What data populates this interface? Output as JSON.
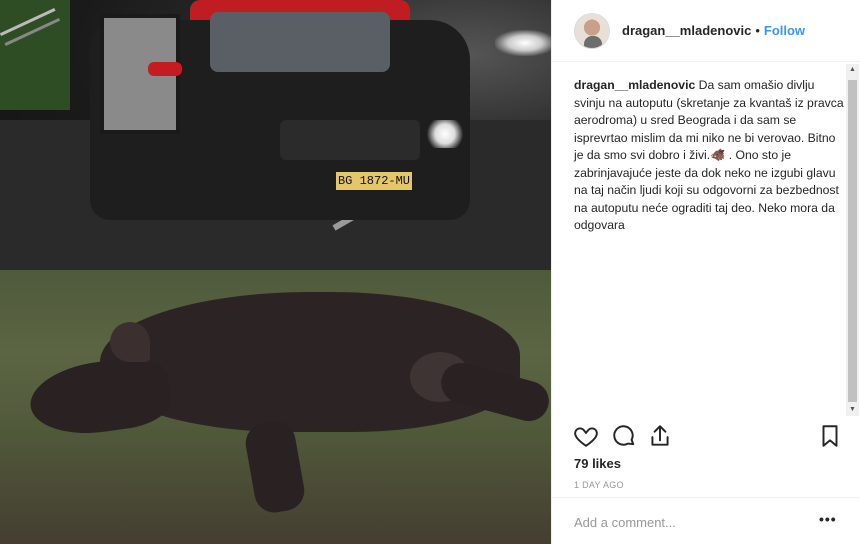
{
  "header": {
    "username": "dragan__mladenovic",
    "separator": "•",
    "follow_label": "Follow"
  },
  "post": {
    "author": "dragan__mladenovic",
    "caption": "Da sam omašio divlju svinju na autoputu (skretanje za kvantaš iz pravca aerodroma) u sred Beograda i da sam se isprevrtao mislim da mi niko ne bi verovao. Bitno je da smo svi dobro i živi.🐗 . Ono sto je zabrinjavajuće jeste da dok neko ne izgubi glavu na taj način ljudi koji su odgovorni za bezbednost na autoputu neće ograditi taj deo. Neko mora da odgovara",
    "likes": "79 likes",
    "timestamp": "1 DAY AGO",
    "plate": "BG 1872-MU"
  },
  "comment_box": {
    "placeholder": "Add a comment...",
    "more_label": "•••"
  },
  "icons": {
    "like": "heart-icon",
    "comment": "comment-icon",
    "share": "share-icon",
    "save": "bookmark-icon"
  },
  "colors": {
    "link": "#3897f0",
    "text": "#262626",
    "muted": "#999999"
  }
}
